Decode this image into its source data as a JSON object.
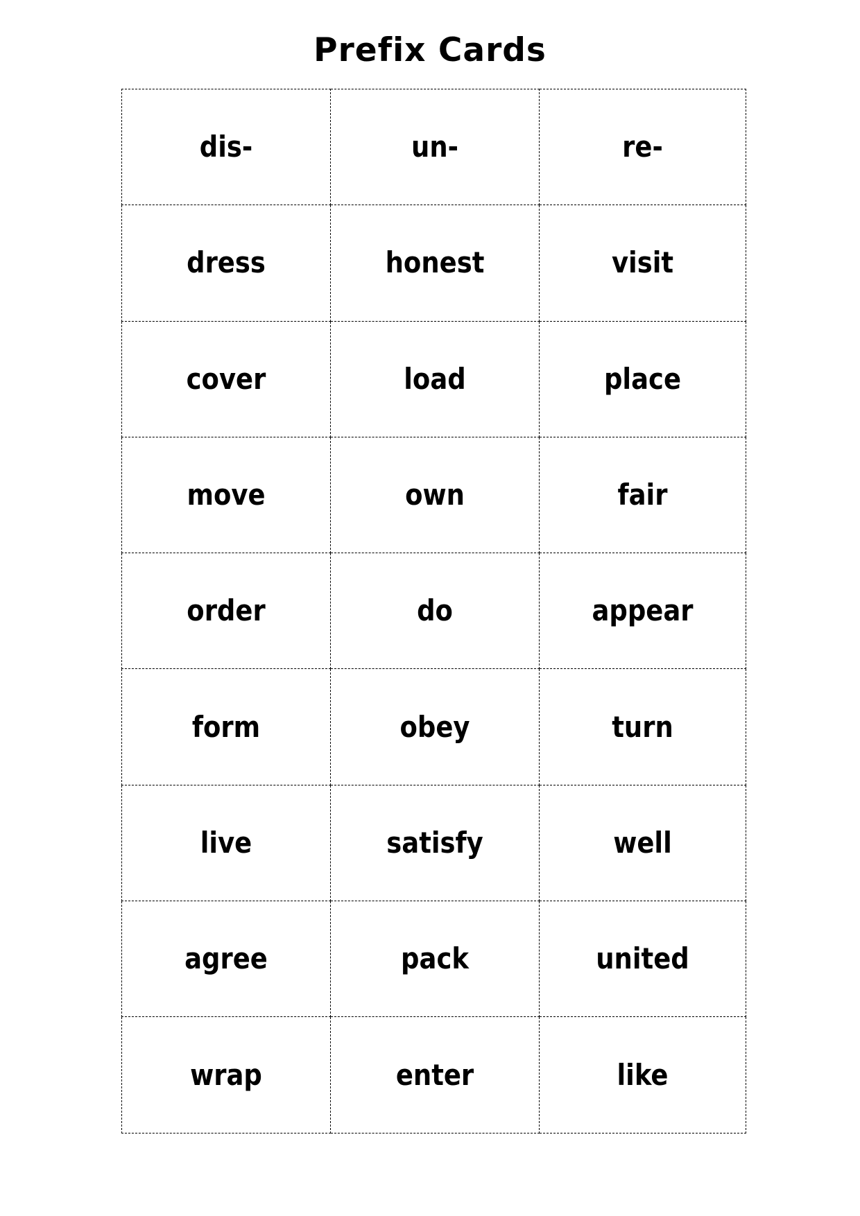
{
  "worksheet": {
    "title": "Prefix Cards"
  },
  "table": {
    "columns": 3,
    "rows": 9,
    "cells": [
      [
        "dis-",
        "un-",
        "re-"
      ],
      [
        "dress",
        "honest",
        "visit"
      ],
      [
        "cover",
        "load",
        "place"
      ],
      [
        "move",
        "own",
        "fair"
      ],
      [
        "order",
        "do",
        "appear"
      ],
      [
        "form",
        "obey",
        "turn"
      ],
      [
        "live",
        "satisfy",
        "well"
      ],
      [
        "agree",
        "pack",
        "united"
      ],
      [
        "wrap",
        "enter",
        "like"
      ]
    ]
  },
  "style": {
    "text_color": "#000000",
    "background_color": "#ffffff",
    "border_style": "dashed"
  }
}
